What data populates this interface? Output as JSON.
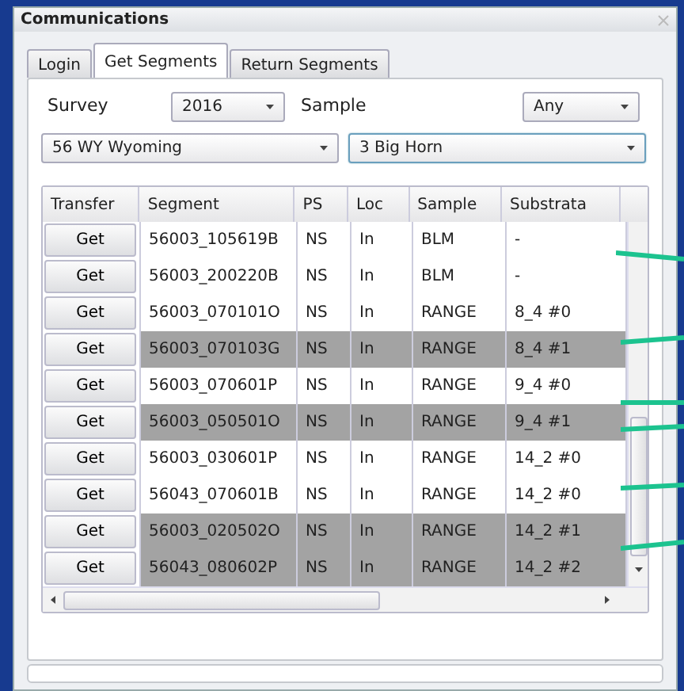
{
  "window": {
    "title": "Communications"
  },
  "tabs": [
    {
      "label": "Login",
      "selected": false
    },
    {
      "label": "Get Segments",
      "selected": true
    },
    {
      "label": "Return Segments",
      "selected": false
    }
  ],
  "filters": {
    "survey_label": "Survey",
    "survey": "2016",
    "sample_label": "Sample",
    "sample": "Any",
    "state": "56 WY Wyoming",
    "county": "3 Big Horn",
    "county_focused": true
  },
  "table": {
    "columns": [
      "Transfer",
      "Segment",
      "PS",
      "Loc",
      "Sample",
      "Substrata"
    ],
    "rows": [
      {
        "cells": [
          "Get",
          "56003_105619B",
          "NS",
          "In",
          "BLM",
          "-"
        ],
        "highlighted": false
      },
      {
        "cells": [
          "Get",
          "56003_200220B",
          "NS",
          "In",
          "BLM",
          "-"
        ],
        "highlighted": false
      },
      {
        "cells": [
          "Get",
          "56003_070101O",
          "NS",
          "In",
          "RANGE",
          "8_4 #0"
        ],
        "highlighted": false
      },
      {
        "cells": [
          "Get",
          "56003_070103G",
          "NS",
          "In",
          "RANGE",
          "8_4 #1"
        ],
        "highlighted": true
      },
      {
        "cells": [
          "Get",
          "56003_070601P",
          "NS",
          "In",
          "RANGE",
          "9_4 #0"
        ],
        "highlighted": false
      },
      {
        "cells": [
          "Get",
          "56003_050501O",
          "NS",
          "In",
          "RANGE",
          "9_4 #1"
        ],
        "highlighted": true
      },
      {
        "cells": [
          "Get",
          "56003_030601P",
          "NS",
          "In",
          "RANGE",
          "14_2 #0"
        ],
        "highlighted": false
      },
      {
        "cells": [
          "Get",
          "56043_070601B",
          "NS",
          "In",
          "RANGE",
          "14_2 #0"
        ],
        "highlighted": false
      },
      {
        "cells": [
          "Get",
          "56003_020502O",
          "NS",
          "In",
          "RANGE",
          "14_2 #1"
        ],
        "highlighted": true
      },
      {
        "cells": [
          "Get",
          "56043_080602P",
          "NS",
          "In",
          "RANGE",
          "14_2 #2"
        ],
        "highlighted": true
      }
    ]
  }
}
